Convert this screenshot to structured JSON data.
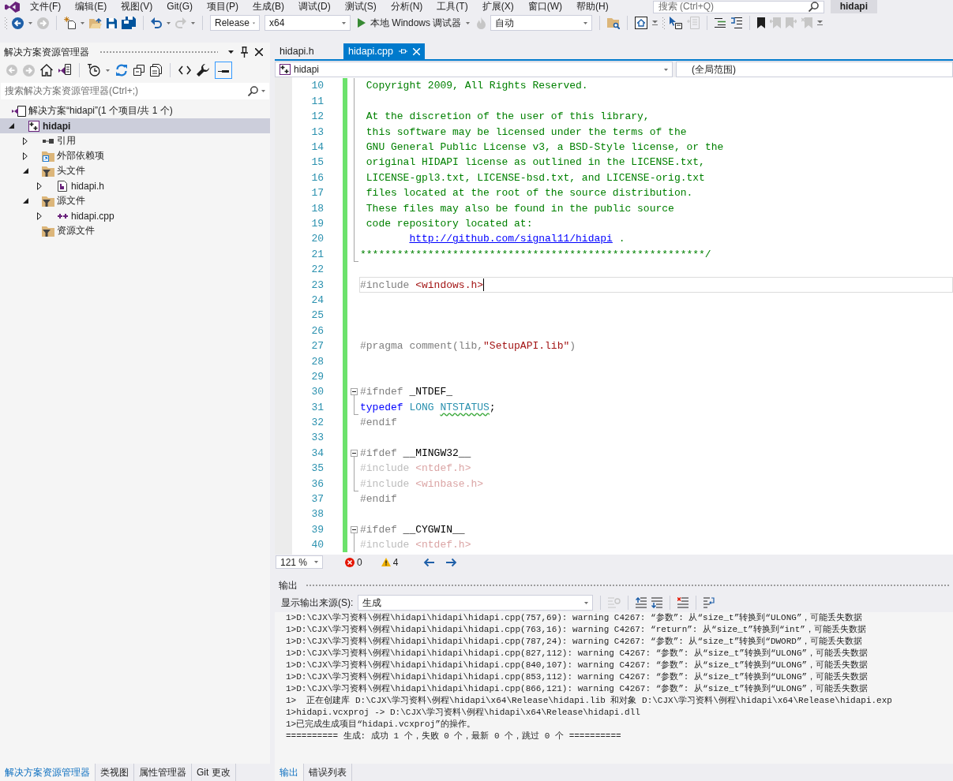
{
  "menu_bar": {
    "items": [
      "文件(F)",
      "编辑(E)",
      "视图(V)",
      "Git(G)",
      "项目(P)",
      "生成(B)",
      "调试(D)",
      "测试(S)",
      "分析(N)",
      "工具(T)",
      "扩展(X)",
      "窗口(W)",
      "帮助(H)"
    ],
    "search": {
      "placeholder": "搜索 (Ctrl+Q)"
    },
    "solution_name": "hidapi"
  },
  "toolbar": {
    "configuration": "Release",
    "platform": "x64",
    "debugger": "本地 Windows 调试器",
    "mode": "自动"
  },
  "solution_explorer": {
    "title": "解决方案资源管理器",
    "toggle_on": true,
    "search": {
      "placeholder": "搜索解决方案资源管理器(Ctrl+;)"
    },
    "tree": [
      {
        "label": "解决方案“hidapi”(1 个项目/共 1 个)",
        "kind": "solution",
        "has_expander": false,
        "expanded": true,
        "selected": false,
        "children": [
          {
            "label": "hidapi",
            "kind": "project",
            "has_expander": true,
            "expanded": true,
            "selected": true,
            "children": [
              {
                "label": "引用",
                "kind": "references",
                "has_expander": true,
                "expanded": false,
                "selected": false
              },
              {
                "label": "外部依赖项",
                "kind": "external",
                "has_expander": true,
                "expanded": false,
                "selected": false
              },
              {
                "label": "头文件",
                "kind": "filter",
                "has_expander": true,
                "expanded": true,
                "selected": false,
                "children": [
                  {
                    "label": "hidapi.h",
                    "kind": "header",
                    "has_expander": true,
                    "expanded": false,
                    "selected": false
                  }
                ]
              },
              {
                "label": "源文件",
                "kind": "filter",
                "has_expander": true,
                "expanded": true,
                "selected": false,
                "children": [
                  {
                    "label": "hidapi.cpp",
                    "kind": "source",
                    "has_expander": true,
                    "expanded": false,
                    "selected": false
                  }
                ]
              },
              {
                "label": "资源文件",
                "kind": "filter",
                "has_expander": false,
                "selected": false
              }
            ]
          }
        ]
      }
    ],
    "tabs": [
      {
        "label": "解决方案资源管理器",
        "selected": true
      },
      {
        "label": "类视图",
        "selected": false
      },
      {
        "label": "属性管理器",
        "selected": false
      },
      {
        "label": "Git 更改",
        "selected": false
      }
    ]
  },
  "editor": {
    "tabs": [
      {
        "label": "hidapi.h",
        "selected": false
      },
      {
        "label": "hidapi.cpp",
        "selected": true
      }
    ],
    "project": "hidapi",
    "scope": "(全局范围)",
    "lines": [
      {
        "number": "10",
        "kind": "inside",
        "changed": true,
        "current": false,
        "segments": [
          {
            "kind": "comment",
            "text": " Copyright 2009, All Rights Reserved."
          }
        ]
      },
      {
        "number": "11",
        "kind": "inside",
        "changed": true,
        "current": false
      },
      {
        "number": "12",
        "kind": "inside",
        "changed": true,
        "current": false,
        "segments": [
          {
            "kind": "comment",
            "text": " At the discretion of the user of this library,"
          }
        ]
      },
      {
        "number": "13",
        "kind": "inside",
        "changed": true,
        "current": false,
        "segments": [
          {
            "kind": "comment",
            "text": " this software may be licensed under the terms of the"
          }
        ]
      },
      {
        "number": "14",
        "kind": "inside",
        "changed": true,
        "current": false,
        "segments": [
          {
            "kind": "comment",
            "text": " GNU General Public License v3, a BSD-Style license, or the"
          }
        ]
      },
      {
        "number": "15",
        "kind": "inside",
        "changed": true,
        "current": false,
        "segments": [
          {
            "kind": "comment",
            "text": " original HIDAPI license as outlined in the LICENSE.txt,"
          }
        ]
      },
      {
        "number": "16",
        "kind": "inside",
        "changed": true,
        "current": false,
        "segments": [
          {
            "kind": "comment",
            "text": " LICENSE-gpl3.txt, LICENSE-bsd.txt, and LICENSE-orig.txt"
          }
        ]
      },
      {
        "number": "17",
        "kind": "inside",
        "changed": true,
        "current": false,
        "segments": [
          {
            "kind": "comment",
            "text": " files located at the root of the source distribution."
          }
        ]
      },
      {
        "number": "18",
        "kind": "inside",
        "changed": true,
        "current": false,
        "segments": [
          {
            "kind": "comment",
            "text": " These files may also be found in the public source"
          }
        ]
      },
      {
        "number": "19",
        "kind": "inside",
        "changed": true,
        "current": false,
        "segments": [
          {
            "kind": "comment",
            "text": " code repository located at:"
          }
        ]
      },
      {
        "number": "20",
        "kind": "inside",
        "changed": true,
        "current": false,
        "segments": [
          {
            "kind": "link",
            "text": "        http://github.com/signal11/hidapi"
          },
          {
            "kind": "comment",
            "text": " ."
          }
        ]
      },
      {
        "number": "21",
        "kind": "end",
        "changed": true,
        "current": false,
        "segments": [
          {
            "kind": "comment",
            "text": "********************************************************/"
          }
        ]
      },
      {
        "number": "22",
        "kind": "plain",
        "changed": true,
        "current": false
      },
      {
        "number": "23",
        "kind": "plain",
        "changed": true,
        "current": true,
        "segments": [
          {
            "kind": "preprocessor",
            "text": "#include "
          },
          {
            "kind": "header",
            "text": "<windows.h>"
          }
        ]
      },
      {
        "number": "24",
        "kind": "plain",
        "changed": true,
        "current": false
      },
      {
        "number": "25",
        "kind": "plain",
        "changed": true,
        "current": false
      },
      {
        "number": "26",
        "kind": "plain",
        "changed": true,
        "current": false
      },
      {
        "number": "27",
        "kind": "plain",
        "changed": true,
        "current": false,
        "segments": [
          {
            "kind": "preprocessor",
            "text": "#pragma comment(lib,"
          },
          {
            "kind": "string",
            "text": "\"SetupAPI.lib\""
          },
          {
            "kind": "preprocessor",
            "text": ")"
          }
        ]
      },
      {
        "number": "28",
        "kind": "plain",
        "changed": true,
        "current": false
      },
      {
        "number": "29",
        "kind": "plain",
        "changed": true,
        "current": false
      },
      {
        "number": "30",
        "kind": "start",
        "changed": true,
        "current": false,
        "segments": [
          {
            "kind": "preprocessor",
            "text": "#ifndef "
          },
          {
            "kind": "plain",
            "text": "_NTDEF_"
          }
        ]
      },
      {
        "number": "31",
        "kind": "end",
        "changed": true,
        "current": false,
        "segments": [
          {
            "kind": "keyword",
            "text": "typedef "
          },
          {
            "kind": "type",
            "text": "LONG "
          },
          {
            "kind": "warned",
            "text": "NTSTATUS"
          },
          {
            "kind": "plain",
            "text": ";"
          }
        ]
      },
      {
        "number": "32",
        "kind": "plain",
        "changed": true,
        "current": false,
        "segments": [
          {
            "kind": "preprocessor",
            "text": "#endif"
          }
        ]
      },
      {
        "number": "33",
        "kind": "plain",
        "changed": true,
        "current": false
      },
      {
        "number": "34",
        "kind": "start",
        "changed": true,
        "current": false,
        "segments": [
          {
            "kind": "preprocessor",
            "text": "#ifdef "
          },
          {
            "kind": "plain",
            "text": "__MINGW32__"
          }
        ]
      },
      {
        "number": "35",
        "kind": "inside",
        "changed": true,
        "current": false,
        "segments": [
          {
            "kind": "inactive",
            "text": "#include "
          },
          {
            "kind": "inactive_header",
            "text": "<ntdef.h>"
          }
        ]
      },
      {
        "number": "36",
        "kind": "end",
        "changed": true,
        "current": false,
        "segments": [
          {
            "kind": "inactive",
            "text": "#include "
          },
          {
            "kind": "inactive_header",
            "text": "<winbase.h>"
          }
        ]
      },
      {
        "number": "37",
        "kind": "plain",
        "changed": true,
        "current": false,
        "segments": [
          {
            "kind": "preprocessor",
            "text": "#endif"
          }
        ]
      },
      {
        "number": "38",
        "kind": "plain",
        "changed": true,
        "current": false
      },
      {
        "number": "39",
        "kind": "start",
        "changed": true,
        "current": false,
        "segments": [
          {
            "kind": "preprocessor",
            "text": "#ifdef "
          },
          {
            "kind": "plain",
            "text": "__CYGWIN__"
          }
        ]
      },
      {
        "number": "40",
        "kind": "inside",
        "changed": true,
        "current": false,
        "segments": [
          {
            "kind": "inactive",
            "text": "#include "
          },
          {
            "kind": "inactive_header",
            "text": "<ntdef.h>"
          }
        ]
      }
    ],
    "zoom": "121 %",
    "errors": "0",
    "warnings": "4"
  },
  "output": {
    "title": "输出",
    "source_label": "显示输出来源(S):",
    "source": "生成",
    "lines": [
      "1>D:\\CJX\\学习资料\\例程\\hidapi\\hidapi\\hidapi.cpp(757,69): warning C4267: “参数”: 从“size_t”转换到“ULONG”，可能丢失数据",
      "1>D:\\CJX\\学习资料\\例程\\hidapi\\hidapi\\hidapi.cpp(763,16): warning C4267: “return”: 从“size_t”转换到“int”，可能丢失数据",
      "1>D:\\CJX\\学习资料\\例程\\hidapi\\hidapi\\hidapi.cpp(787,24): warning C4267: “参数”: 从“size_t”转换到“DWORD”，可能丢失数据",
      "1>D:\\CJX\\学习资料\\例程\\hidapi\\hidapi\\hidapi.cpp(827,112): warning C4267: “参数”: 从“size_t”转换到“ULONG”，可能丢失数据",
      "1>D:\\CJX\\学习资料\\例程\\hidapi\\hidapi\\hidapi.cpp(840,107): warning C4267: “参数”: 从“size_t”转换到“ULONG”，可能丢失数据",
      "1>D:\\CJX\\学习资料\\例程\\hidapi\\hidapi\\hidapi.cpp(853,112): warning C4267: “参数”: 从“size_t”转换到“ULONG”，可能丢失数据",
      "1>D:\\CJX\\学习资料\\例程\\hidapi\\hidapi\\hidapi.cpp(866,121): warning C4267: “参数”: 从“size_t”转换到“ULONG”，可能丢失数据",
      "1>  正在创建库 D:\\CJX\\学习资料\\例程\\hidapi\\x64\\Release\\hidapi.lib 和对象 D:\\CJX\\学习资料\\例程\\hidapi\\x64\\Release\\hidapi.exp",
      "1>hidapi.vcxproj -> D:\\CJX\\学习资料\\例程\\hidapi\\x64\\Release\\hidapi.dll",
      "1>已完成生成项目“hidapi.vcxproj”的操作。",
      "========== 生成: 成功 1 个，失败 0 个，最新 0 个，跳过 0 个 =========="
    ],
    "tabs": [
      {
        "label": "输出",
        "selected": true
      },
      {
        "label": "错误列表",
        "selected": false
      }
    ]
  }
}
